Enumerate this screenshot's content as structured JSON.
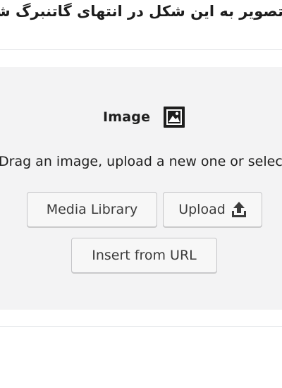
{
  "heading": {
    "text": "تصویر به این شکل در انتهای گاتنبرگ شد"
  },
  "placeholder": {
    "title": "Image",
    "title_icon": "image-icon",
    "instructions": "Drag an image, upload a new one or select a file from your library.",
    "buttons": {
      "media_library": "Media Library",
      "upload": "Upload",
      "upload_icon": "upload-icon",
      "insert_from_url": "Insert from URL"
    }
  },
  "colors": {
    "placeholder_bg": "#f3f3f4",
    "text": "#1e1e1e",
    "button_border": "#c5c5c8",
    "button_bg": "#f7f7f7"
  }
}
